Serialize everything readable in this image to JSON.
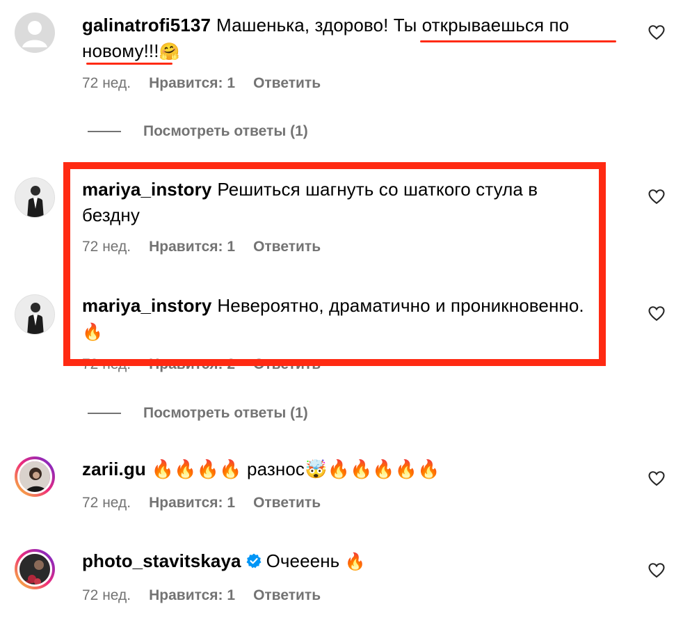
{
  "comments": [
    {
      "username": "galinatrofi5137",
      "text_plain": "Машенька, здорово! ",
      "text_highlight": "Ты открываешься по новому!!!",
      "emoji": "🤗",
      "time": "72 нед.",
      "likes": "Нравится: 1",
      "reply": "Ответить",
      "view_replies": "Посмотреть ответы (1)"
    },
    {
      "username": "mariya_instory",
      "text": "Решиться шагнуть со шаткого стула в бездну",
      "time": "72 нед.",
      "likes": "Нравится: 1",
      "reply": "Ответить"
    },
    {
      "username": "mariya_instory",
      "text": "Невероятно, драматично и проникновенно. ",
      "emoji": "🔥",
      "time": "72 нед.",
      "likes": "Нравится: 2",
      "reply": "Ответить",
      "view_replies": "Посмотреть ответы (1)"
    },
    {
      "username": "zarii.gu",
      "text": "🔥🔥🔥🔥 разнос🤯🔥🔥🔥🔥🔥",
      "time": "72 нед.",
      "likes": "Нравится: 1",
      "reply": "Ответить"
    },
    {
      "username": "photo_stavitskaya",
      "verified": true,
      "text": "Очееень ",
      "emoji": "🔥",
      "time": "72 нед.",
      "likes": "Нравится: 1",
      "reply": "Ответить"
    }
  ],
  "colors": {
    "highlight_red": "#ff2a12",
    "meta_gray": "#737373",
    "verified_blue": "#0095f6"
  }
}
